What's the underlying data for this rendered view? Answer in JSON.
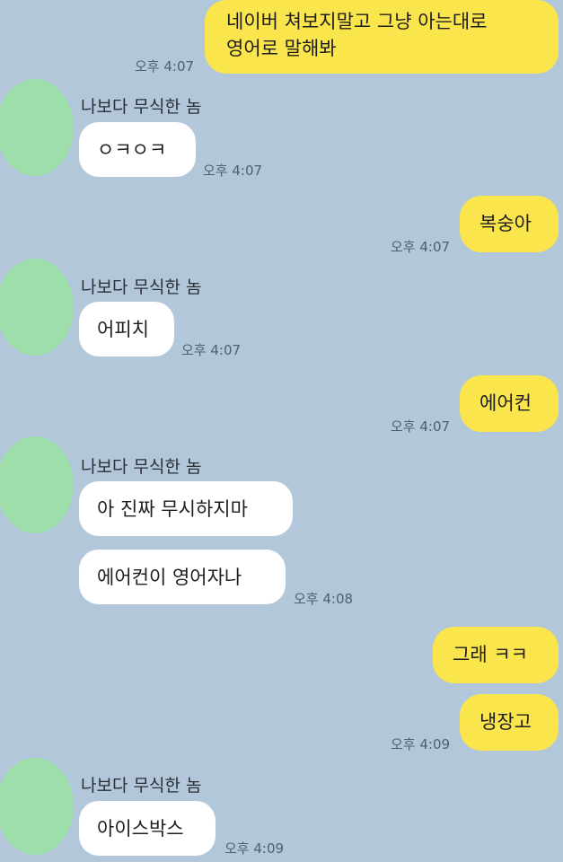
{
  "chat": {
    "sender_name": "나보다 무식한 놈",
    "messages": [
      {
        "from": "me",
        "lines": [
          "네이버 쳐보지말고 그냥 아는대로",
          "영어로 말해봐"
        ],
        "time": "오후 4:07"
      },
      {
        "from": "them",
        "text": "ㅇㅋㅇㅋ",
        "time": "오후 4:07"
      },
      {
        "from": "me",
        "text": "복숭아",
        "time": "오후 4:07"
      },
      {
        "from": "them",
        "text": "어피치",
        "time": "오후 4:07"
      },
      {
        "from": "me",
        "text": "에어컨",
        "time": "오후 4:07"
      },
      {
        "from": "them",
        "text": "아 진짜 무시하지마"
      },
      {
        "from": "them",
        "text": "에어컨이 영어자나",
        "time": "오후 4:08"
      },
      {
        "from": "me",
        "text": "그래 ㅋㅋ"
      },
      {
        "from": "me",
        "text": "냉장고",
        "time": "오후 4:09"
      },
      {
        "from": "them",
        "text": "아이스박스",
        "time": "오후 4:09"
      }
    ]
  },
  "colors": {
    "background": "#b2c7d9",
    "outgoing_bubble": "#fbe54d",
    "incoming_bubble": "#ffffff",
    "avatar_blur": "#9ddfa8"
  }
}
